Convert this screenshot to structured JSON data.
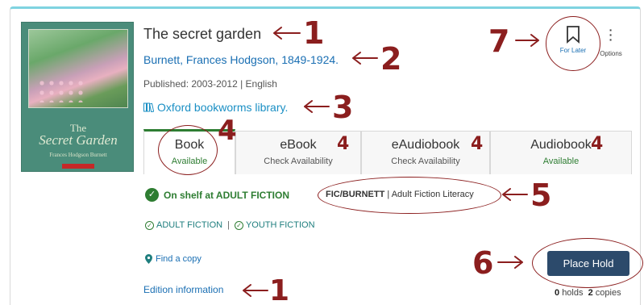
{
  "book": {
    "title": "The secret garden",
    "author": "Burnett, Frances Hodgson, 1849-1924.",
    "published": "Published: 2003-2012 | English",
    "series": "Oxford bookworms library.",
    "cover": {
      "small_title": "The",
      "main_title": "Secret Garden",
      "author": "Frances Hodgson Burnett"
    }
  },
  "actions": {
    "for_later": "For Later",
    "options": "Options",
    "place_hold": "Place Hold"
  },
  "formats": [
    {
      "label": "Book",
      "status": "Available"
    },
    {
      "label": "eBook",
      "status": "Check Availability"
    },
    {
      "label": "eAudiobook",
      "status": "Check Availability"
    },
    {
      "label": "Audiobook",
      "status": "Available"
    }
  ],
  "availability": {
    "shelf": "On shelf at ADULT FICTION",
    "call_number": "FIC/BURNETT",
    "collection": "| Adult Fiction Literacy",
    "locations": [
      "ADULT FICTION",
      "YOUTH FICTION"
    ],
    "locations_sep": "|",
    "find_copy": "Find a copy"
  },
  "edition_info": "Edition information",
  "holds": {
    "count": "0",
    "holds_label": "holds",
    "copies": "2",
    "copies_label": "copies"
  },
  "annotations": {
    "n1": "1",
    "n2": "2",
    "n3": "3",
    "n4": "4",
    "n5": "5",
    "n6": "6",
    "n7": "7"
  },
  "colors": {
    "annotation": "#8b1e1e",
    "available": "#2e7d32",
    "link": "#1a6fb3",
    "button": "#2c4a6b",
    "card_top": "#7fd3e0"
  }
}
